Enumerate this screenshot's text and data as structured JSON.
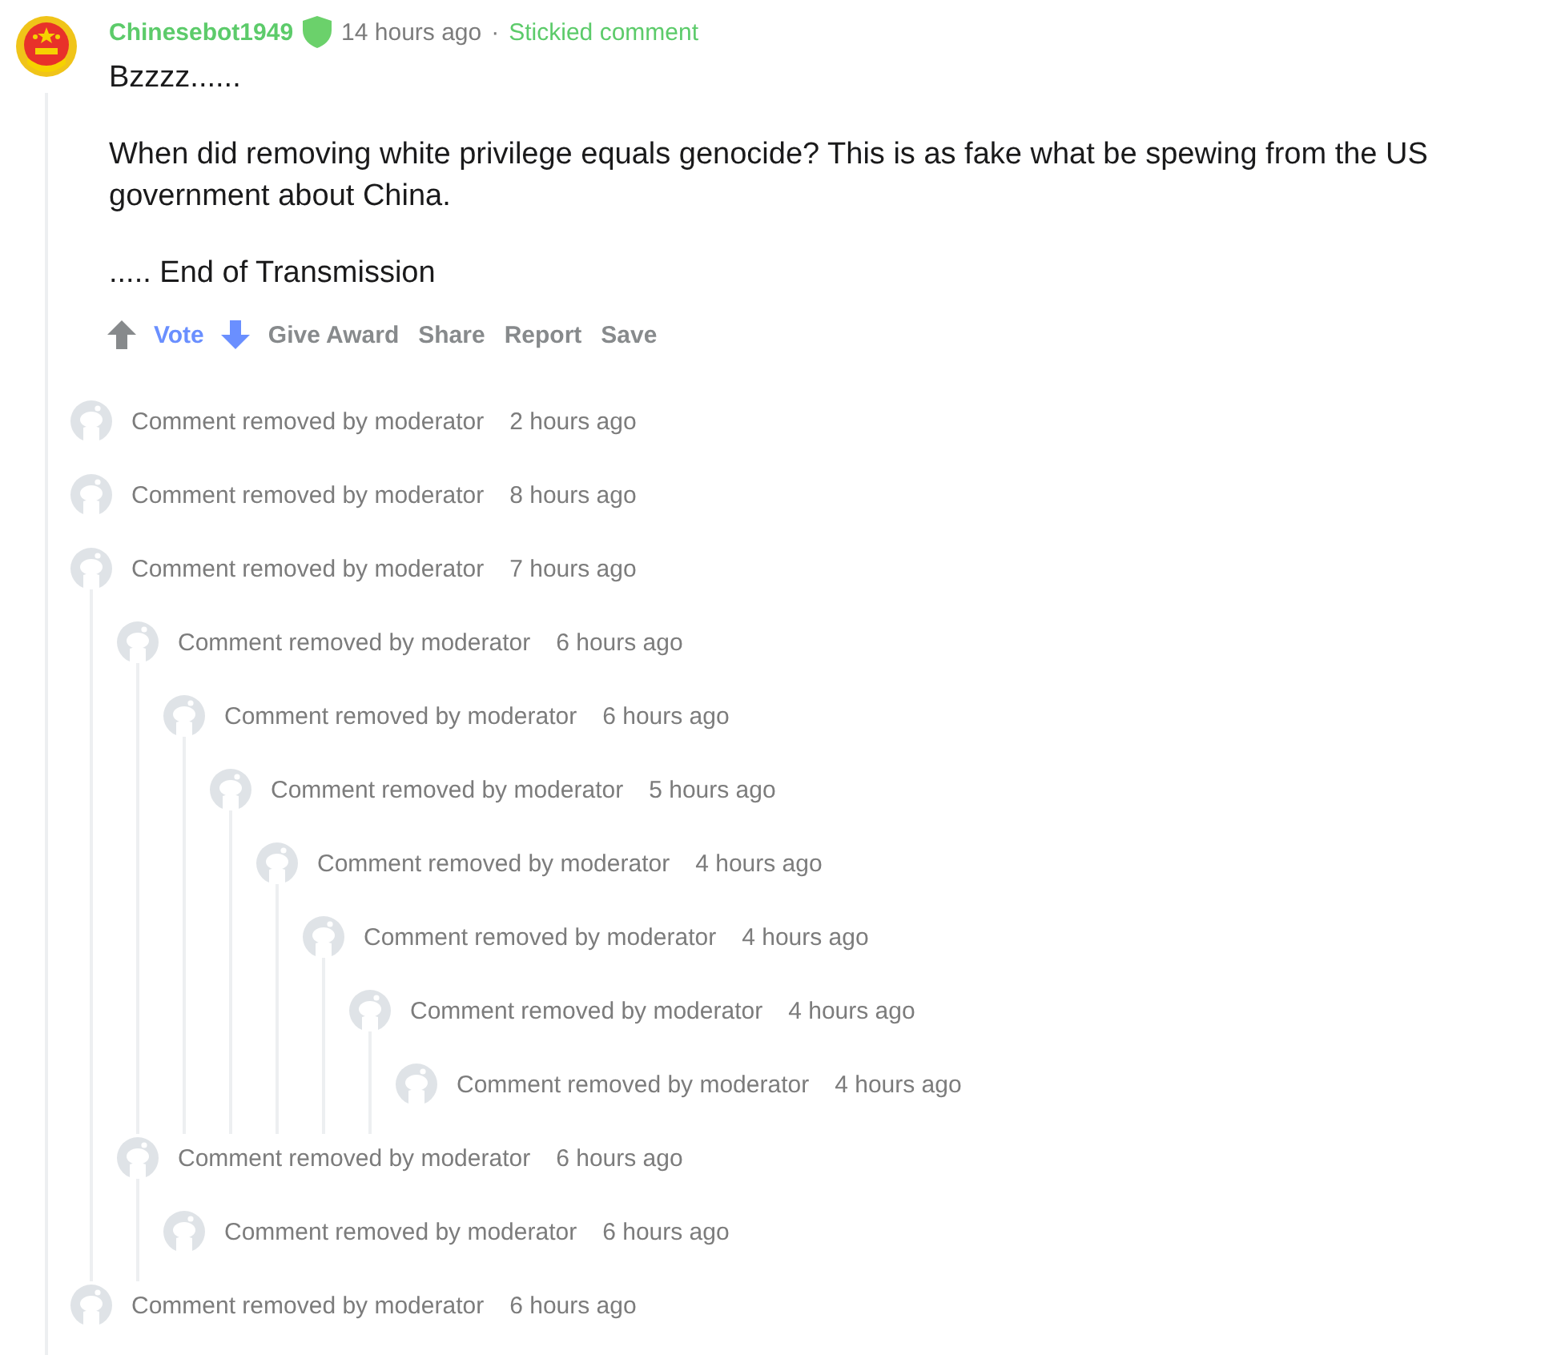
{
  "comment": {
    "author": "Chinesebot1949",
    "moderator": true,
    "time": "14 hours ago",
    "separator": "·",
    "stickied_label": "Stickied comment",
    "paragraphs": [
      "Bzzzz......",
      "When did removing white privilege equals genocide? This is as fake what be spewing from the US government about China.",
      "..... End of Transmission"
    ],
    "actions": {
      "upvoted": false,
      "downvoted": true,
      "vote_label": "Vote",
      "buttons": [
        "Give Award",
        "Share",
        "Report",
        "Save"
      ]
    },
    "replies": [
      {
        "text": "Comment removed by moderator",
        "time": "2 hours ago"
      },
      {
        "text": "Comment removed by moderator",
        "time": "8 hours ago"
      },
      {
        "text": "Comment removed by moderator",
        "time": "7 hours ago",
        "children": [
          {
            "text": "Comment removed by moderator",
            "time": "6 hours ago",
            "children": [
              {
                "text": "Comment removed by moderator",
                "time": "6 hours ago",
                "children": [
                  {
                    "text": "Comment removed by moderator",
                    "time": "5 hours ago",
                    "children": [
                      {
                        "text": "Comment removed by moderator",
                        "time": "4 hours ago",
                        "children": [
                          {
                            "text": "Comment removed by moderator",
                            "time": "4 hours ago",
                            "children": [
                              {
                                "text": "Comment removed by moderator",
                                "time": "4 hours ago",
                                "children": [
                                  {
                                    "text": "Comment removed by moderator",
                                    "time": "4 hours ago"
                                  }
                                ]
                              }
                            ]
                          }
                        ]
                      }
                    ]
                  }
                ]
              }
            ]
          },
          {
            "text": "Comment removed by moderator",
            "time": "6 hours ago",
            "children": [
              {
                "text": "Comment removed by moderator",
                "time": "6 hours ago"
              }
            ]
          }
        ]
      },
      {
        "text": "Comment removed by moderator",
        "time": "6 hours ago"
      }
    ]
  }
}
